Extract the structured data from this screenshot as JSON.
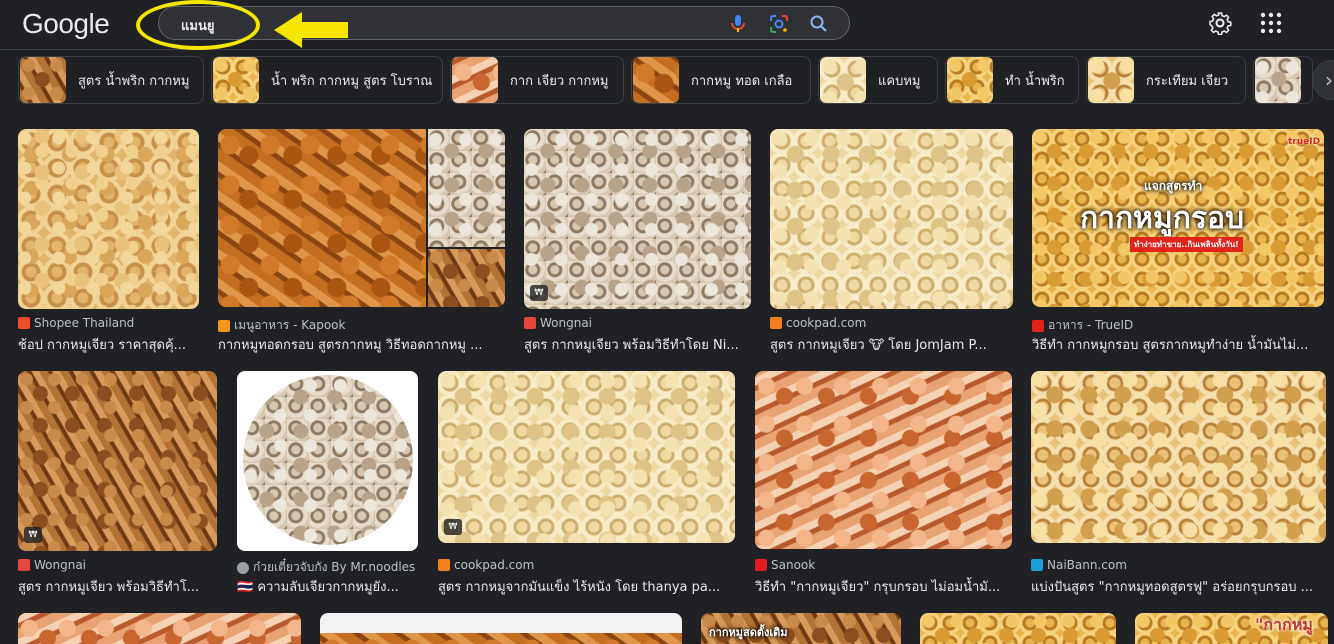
{
  "header": {
    "logo": "Google",
    "search_value": "แมนยู"
  },
  "chips": [
    {
      "label": "สูตร น้ำพริก กากหมู"
    },
    {
      "label": "น้ำ พริก กากหมู สูตร โบราณ"
    },
    {
      "label": "กาก เจียว กากหมู"
    },
    {
      "label": "กากหมู ทอด เกลือ"
    },
    {
      "label": "แคบหมู"
    },
    {
      "label": "ทำ น้ำพริก"
    },
    {
      "label": "กระเทียม เจียว"
    }
  ],
  "results": [
    {
      "source": "Shopee Thailand",
      "title": "ช้อป กากหมูเจียว ราคาสุดคุ้...",
      "fav_color": "#ee4d2d"
    },
    {
      "source": "เมนูอาหาร - Kapook",
      "title": "กากหมูทอดกรอบ สูตรกากหมู วิธีทอดกากหมู ...",
      "fav_color": "#f7941d"
    },
    {
      "source": "Wongnai",
      "title": "สูตร กากหมูเจียว พร้อมวิธีทำโดย Ni...",
      "fav_color": "#e8453c",
      "badge": "₩"
    },
    {
      "source": "cookpad.com",
      "title": "สูตร กากหมูเจียว 🐮 โดย JomJam P...",
      "fav_color": "#f48120"
    },
    {
      "source": "อาหาร - TrueID",
      "title": "วิธีทำ กากหมูกรอบ สูตรกากหมูทำง่าย น้ำมันไม่...",
      "fav_color": "#e2231a",
      "overlay": "กากหมูกรอบ",
      "overlay_top": "แจกสูตรทำ",
      "overlay_sub": "ทำง่ายทำขาย..กินเพลินทั้งวัน!",
      "brand": "trueID"
    },
    {
      "source": "Wongnai",
      "title": "สูตร กากหมูเจียว พร้อมวิธีทำโ...",
      "fav_color": "#e8453c",
      "badge": "₩"
    },
    {
      "source": "ก๋วยเตี๋ยวจับกัง By Mr.noodles",
      "title": "🇹🇭 ความลับเจียวกากหมูยัง...",
      "fav_color": "#9aa0a6"
    },
    {
      "source": "cookpad.com",
      "title": "สูตร กากหมูจากมันแข็ง ไร้หนัง โดย thanya pa...",
      "fav_color": "#f48120",
      "badge": "₩"
    },
    {
      "source": "Sanook",
      "title": "วิธีทำ \"กากหมูเจียว\" กรุบกรอบ ไม่อมน้ำมั...",
      "fav_color": "#e31b23"
    },
    {
      "source": "NaiBann.com",
      "title": "แบ่งปันสูตร \"กากหมูทอดสูตรฟู\" อร่อยกรุบกรอบ ...",
      "fav_color": "#1a9fd9"
    }
  ],
  "row3": {
    "overlay_left": "กากหมูสดตั้งเดิม",
    "overlay_right": "\"กากหมู"
  }
}
